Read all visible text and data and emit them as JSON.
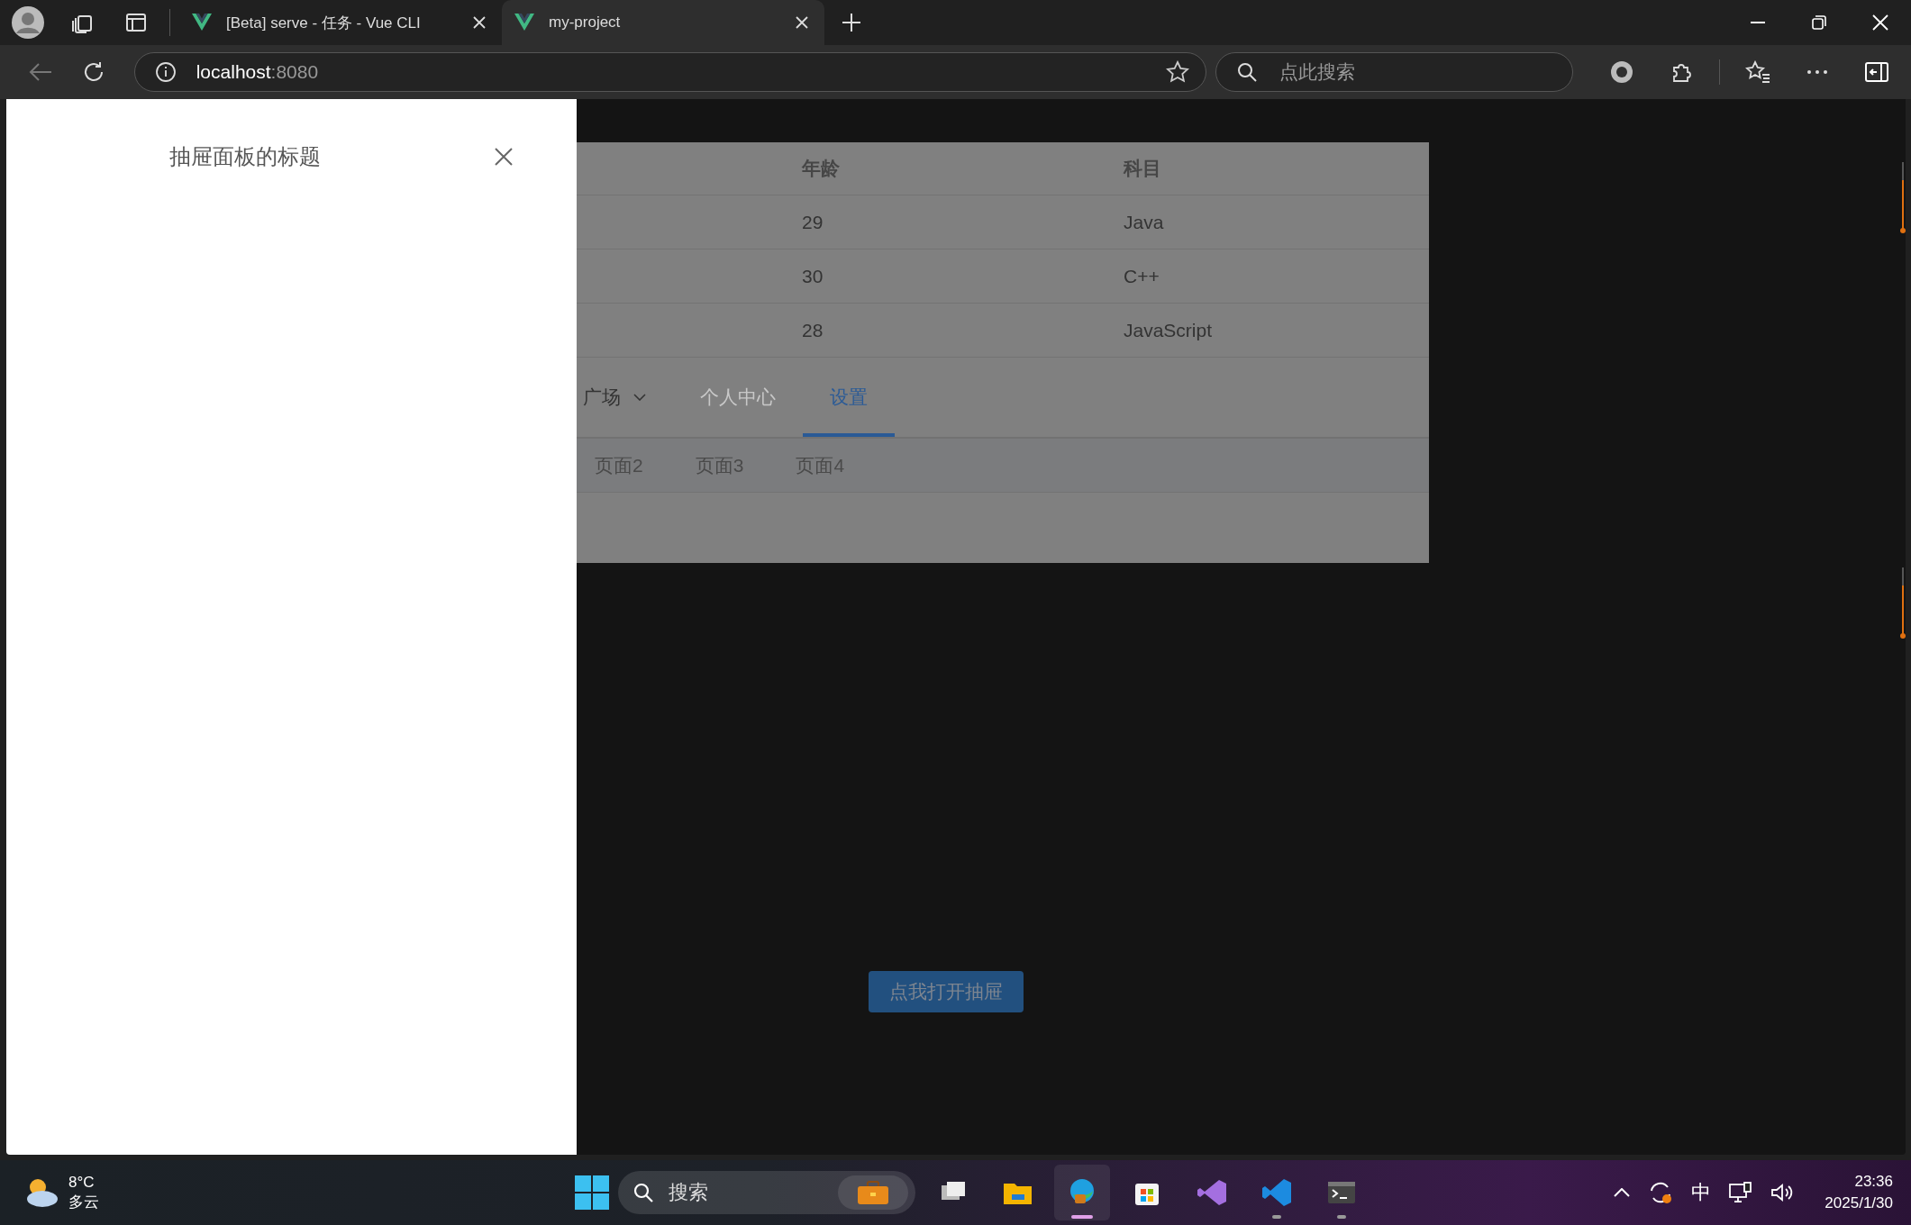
{
  "browser": {
    "tabs": [
      {
        "title": "[Beta] serve - 任务 - Vue CLI",
        "selected": false
      },
      {
        "title": "my-project",
        "selected": true
      }
    ],
    "address": {
      "host": "localhost",
      "port": ":8080"
    },
    "search": {
      "placeholder": "点此搜索"
    }
  },
  "page": {
    "table": {
      "columns": [
        "年龄",
        "科目"
      ],
      "rows": [
        [
          "29",
          "Java"
        ],
        [
          "30",
          "C++"
        ],
        [
          "28",
          "JavaScript"
        ]
      ]
    },
    "menu": [
      {
        "label": "广场",
        "kind": "submenu",
        "selected": false,
        "disabled": false
      },
      {
        "label": "个人中心",
        "kind": "item",
        "selected": false,
        "disabled": true
      },
      {
        "label": "设置",
        "kind": "item",
        "selected": true,
        "disabled": false
      }
    ],
    "submenu": [
      "页面2",
      "页面3",
      "页面4"
    ],
    "open_button": "点我打开抽屉"
  },
  "drawer": {
    "title": "抽屉面板的标题"
  },
  "taskbar": {
    "weather": {
      "temp": "8°C",
      "condition": "多云"
    },
    "search": {
      "placeholder": "搜索"
    },
    "apps": [
      {
        "kind": "task-view",
        "selected": false,
        "running": false
      },
      {
        "kind": "folder",
        "selected": false,
        "running": false
      },
      {
        "kind": "edge",
        "selected": true,
        "running": true
      },
      {
        "kind": "store",
        "selected": false,
        "running": false
      },
      {
        "kind": "studio",
        "selected": false,
        "running": false
      },
      {
        "kind": "code",
        "selected": false,
        "running": true
      },
      {
        "kind": "terminal",
        "selected": false,
        "running": true
      }
    ],
    "ime": "中",
    "time": "23:36",
    "date": "2025/1/30"
  }
}
